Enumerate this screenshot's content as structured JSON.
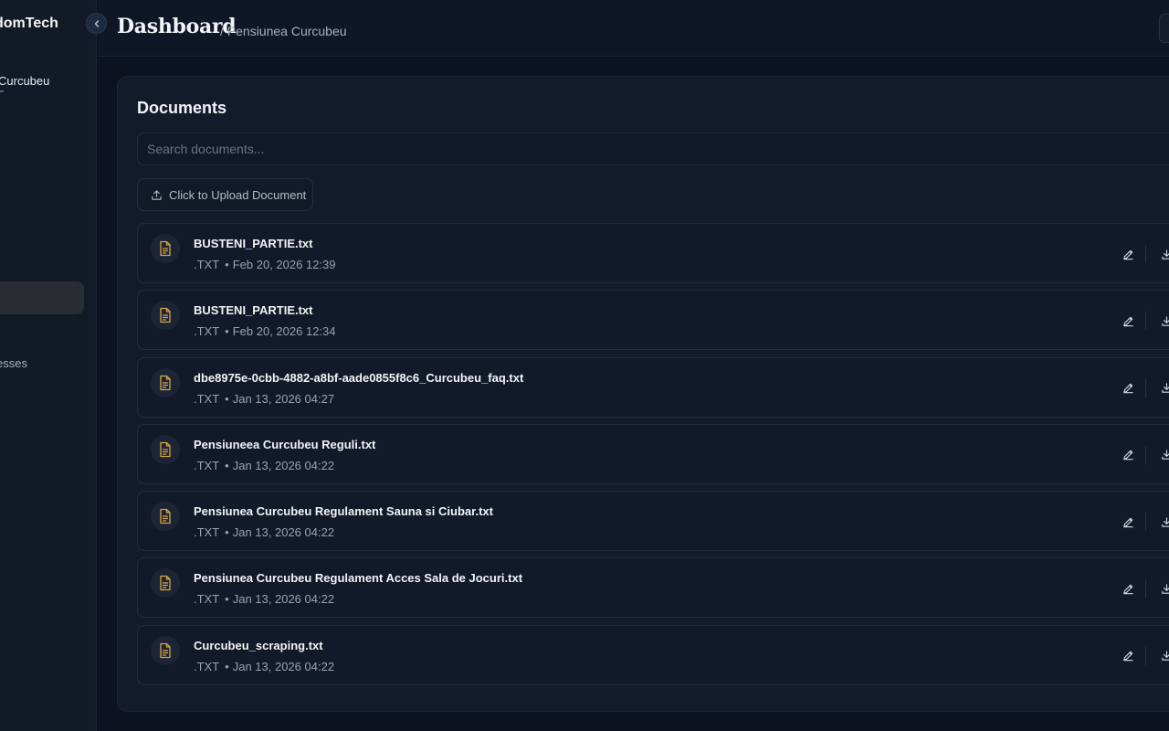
{
  "sidebar": {
    "brand": "domTech",
    "collapse_icon": "chevron-left-icon",
    "property_name": "Curcubeu",
    "nav_item_label": "esses"
  },
  "header": {
    "title": "Dashboard",
    "breadcrumb": "/ Pensiunea Curcubeu"
  },
  "documents": {
    "title": "Documents",
    "search_placeholder": "Search documents...",
    "upload_label": "Click to Upload Document",
    "upload_icon": "upload-icon",
    "file_icon": "file-text-icon",
    "accent_color": "#d9a441",
    "items": [
      {
        "name": "BUSTENI_PARTIE.txt",
        "type": ".TXT",
        "date": "Feb 20, 2026 12:39"
      },
      {
        "name": "BUSTENI_PARTIE.txt",
        "type": ".TXT",
        "date": "Feb 20, 2026 12:34"
      },
      {
        "name": "dbe8975e-0cbb-4882-a8bf-aade0855f8c6_Curcubeu_faq.txt",
        "type": ".TXT",
        "date": "Jan 13, 2026 04:27"
      },
      {
        "name": "Pensiuneea Curcubeu Reguli.txt",
        "type": ".TXT",
        "date": "Jan 13, 2026 04:22"
      },
      {
        "name": "Pensiunea Curcubeu Regulament Sauna si Ciubar.txt",
        "type": ".TXT",
        "date": "Jan 13, 2026 04:22"
      },
      {
        "name": "Pensiunea Curcubeu Regulament Acces Sala de Jocuri.txt",
        "type": ".TXT",
        "date": "Jan 13, 2026 04:22"
      },
      {
        "name": "Curcubeu_scraping.txt",
        "type": ".TXT",
        "date": "Jan 13, 2026 04:22"
      }
    ]
  }
}
